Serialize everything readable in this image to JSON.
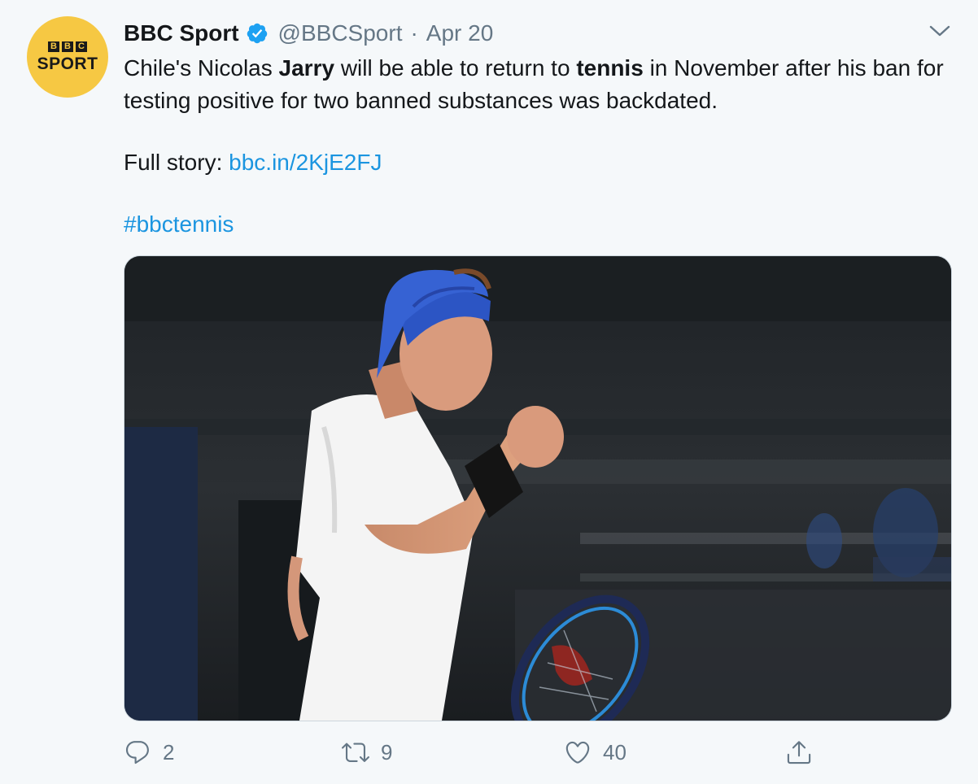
{
  "tweet": {
    "author_name": "BBC Sport",
    "handle": "@BBCSport",
    "separator": "·",
    "date": "Apr 20",
    "avatar": {
      "letters": [
        "B",
        "B",
        "C"
      ],
      "wordmark": "SPORT"
    },
    "text": {
      "line1_a": "Chile's Nicolas ",
      "line1_bold1": "Jarry",
      "line1_b": " will be able to return to ",
      "line1_bold2": "tennis",
      "line1_c": " in November after his ban for testing positive for two banned substances was backdated.",
      "full_story_label": "Full story: ",
      "full_story_link": "bbc.in/2KjE2FJ",
      "hashtag": "#bbctennis"
    },
    "actions": {
      "reply_count": "2",
      "retweet_count": "9",
      "like_count": "40"
    },
    "colors": {
      "link": "#1b95e0",
      "muted": "#657786",
      "verified": "#1da1f2",
      "avatar_bg": "#f6c843"
    },
    "icons": [
      "verified-badge-icon",
      "chevron-down-icon",
      "reply-icon",
      "retweet-icon",
      "like-icon",
      "share-icon"
    ]
  }
}
